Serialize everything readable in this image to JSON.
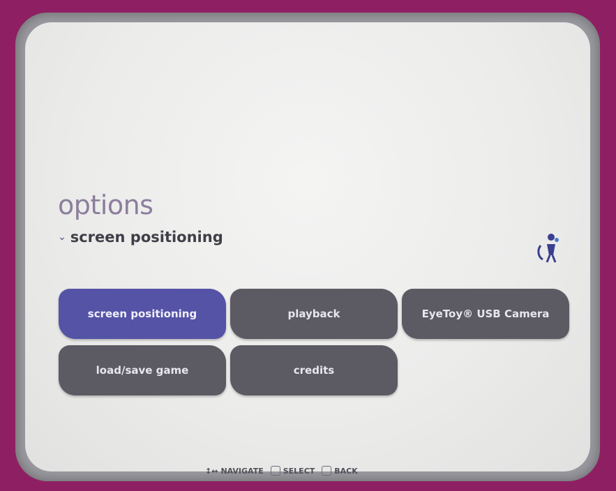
{
  "menu": {
    "title": "options",
    "subtitle": "screen positioning",
    "items": [
      {
        "label": "screen positioning",
        "selected": true
      },
      {
        "label": "playback",
        "selected": false
      },
      {
        "label": "EyeToy® USB Camera",
        "selected": false
      },
      {
        "label": "load/save game",
        "selected": false
      },
      {
        "label": "credits",
        "selected": false
      }
    ]
  },
  "footer": {
    "navigate_label": "NAVIGATE",
    "select_label": "SELECT",
    "back_label": "BACK"
  },
  "colors": {
    "background": "#8f1f63",
    "tile": "#5c5a62",
    "tile_selected": "#5553a6",
    "title": "#8c7e9c"
  },
  "icons": {
    "mascot": "mascot-icon",
    "navigate": "dpad-icon",
    "select": "cross-button-icon",
    "back": "triangle-button-icon"
  }
}
